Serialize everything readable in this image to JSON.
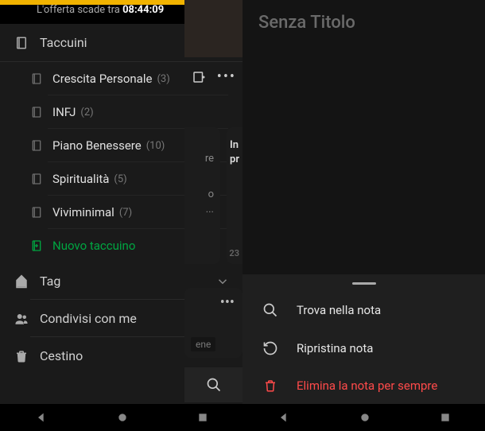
{
  "offer": {
    "prefix": "L'offerta scade tra ",
    "time": "08:44:09"
  },
  "sidebar": {
    "notebooks_label": "Taccuini",
    "items": [
      {
        "label": "Crescita Personale",
        "count": "(3)"
      },
      {
        "label": "INFJ",
        "count": "(2)"
      },
      {
        "label": "Piano Benessere",
        "count": "(10)"
      },
      {
        "label": "Spiritualità",
        "count": "(5)"
      },
      {
        "label": "Viviminimal",
        "count": "(7)"
      }
    ],
    "new_notebook": "Nuovo taccuino",
    "tags_label": "Tag",
    "shared_label": "Condivisi con me",
    "trash_label": "Cestino"
  },
  "backdrop": {
    "card1_lines": [
      "re",
      "o",
      "..."
    ],
    "card2_lines": [
      "In",
      "pr"
    ],
    "card2_page": "23",
    "card3_tag": "ene"
  },
  "right": {
    "title": "Senza Titolo",
    "menu": {
      "find": "Trova nella nota",
      "restore": "Ripristina nota",
      "delete": "Elimina la nota per sempre"
    }
  }
}
